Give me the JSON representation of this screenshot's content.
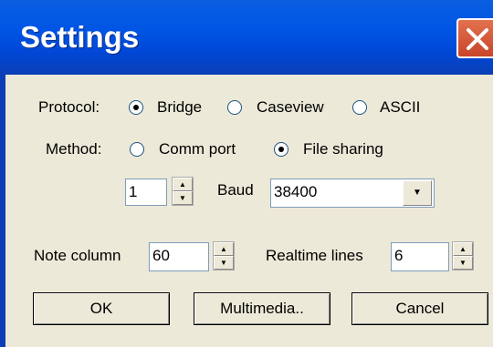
{
  "window": {
    "title": "Settings"
  },
  "protocol": {
    "label": "Protocol:",
    "options": [
      {
        "label": "Bridge",
        "selected": true
      },
      {
        "label": "Caseview",
        "selected": false
      },
      {
        "label": "ASCII",
        "selected": false
      }
    ]
  },
  "method": {
    "label": "Method:",
    "options": [
      {
        "label": "Comm port",
        "selected": false
      },
      {
        "label": "File sharing",
        "selected": true
      }
    ]
  },
  "port": {
    "value": "1"
  },
  "baud": {
    "label": "Baud",
    "value": "38400"
  },
  "note_column": {
    "label": "Note column",
    "value": "60"
  },
  "realtime_lines": {
    "label": "Realtime lines",
    "value": "6"
  },
  "buttons": {
    "ok": "OK",
    "multimedia": "Multimedia..",
    "cancel": "Cancel"
  }
}
